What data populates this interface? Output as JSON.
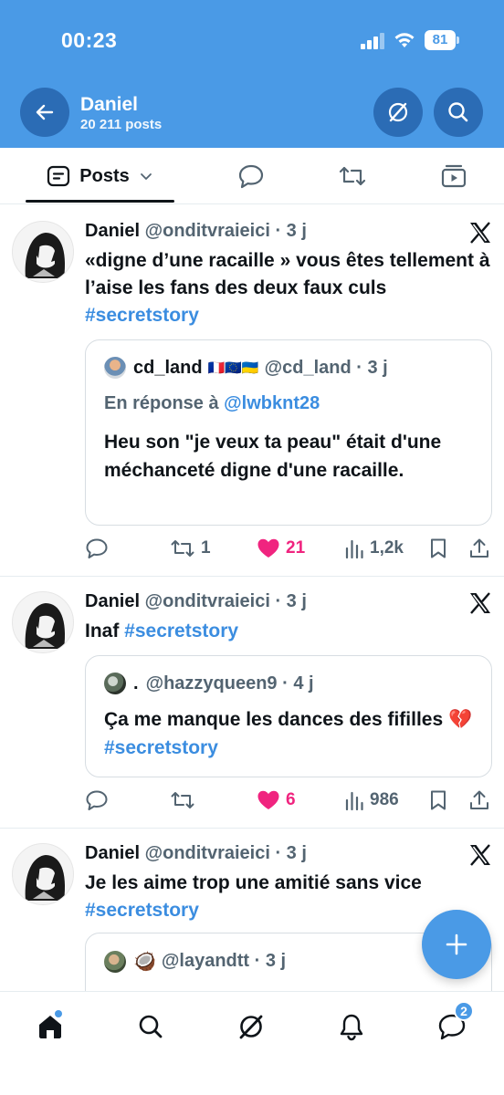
{
  "status_bar": {
    "time": "00:23",
    "battery": "81"
  },
  "header": {
    "name": "Daniel",
    "posts_count": "20 211 posts"
  },
  "tabs": {
    "posts_label": "Posts"
  },
  "colors": {
    "brand": "#4a9ae6",
    "like": "#f0247f",
    "link": "#3b8de0"
  },
  "posts": [
    {
      "name": "Daniel",
      "handle_time": "@onditvraieici · 3 j",
      "text": "«digne d’une racaille »  vous êtes tellement à l’aise les fans des deux faux culs ",
      "hashtag": "#secretstory",
      "quote": {
        "name": "cd_land",
        "flags": "🇫🇷🇪🇺🇺🇦",
        "handle_time": "@cd_land · 3 j",
        "reply_prefix": "En réponse à ",
        "reply_mention": "@lwbknt28",
        "text": "Heu son \"je veux ta peau\" était d'une méchanceté digne d'une racaille."
      },
      "actions": {
        "reposts": "1",
        "likes": "21",
        "views": "1,2k"
      }
    },
    {
      "name": "Daniel",
      "handle_time": "@onditvraieici · 3 j",
      "text": "Inaf ",
      "hashtag": "#secretstory",
      "quote": {
        "name": ".",
        "handle_time": "@hazzyqueen9 · 4 j",
        "text": "Ça me manque les dances des fifilles 💔 ",
        "hashtag": "#secretstory"
      },
      "actions": {
        "reposts": "",
        "likes": "6",
        "views": "986"
      }
    },
    {
      "name": "Daniel",
      "handle_time": "@onditvraieici · 3 j",
      "text": "Je les aime trop une amitié sans vice ",
      "hashtag": "#secretstory",
      "quote": {
        "emoji": "🥥",
        "handle_time": "@layandtt · 3 j"
      }
    }
  ],
  "bottom_nav": {
    "messages_badge": "2"
  }
}
